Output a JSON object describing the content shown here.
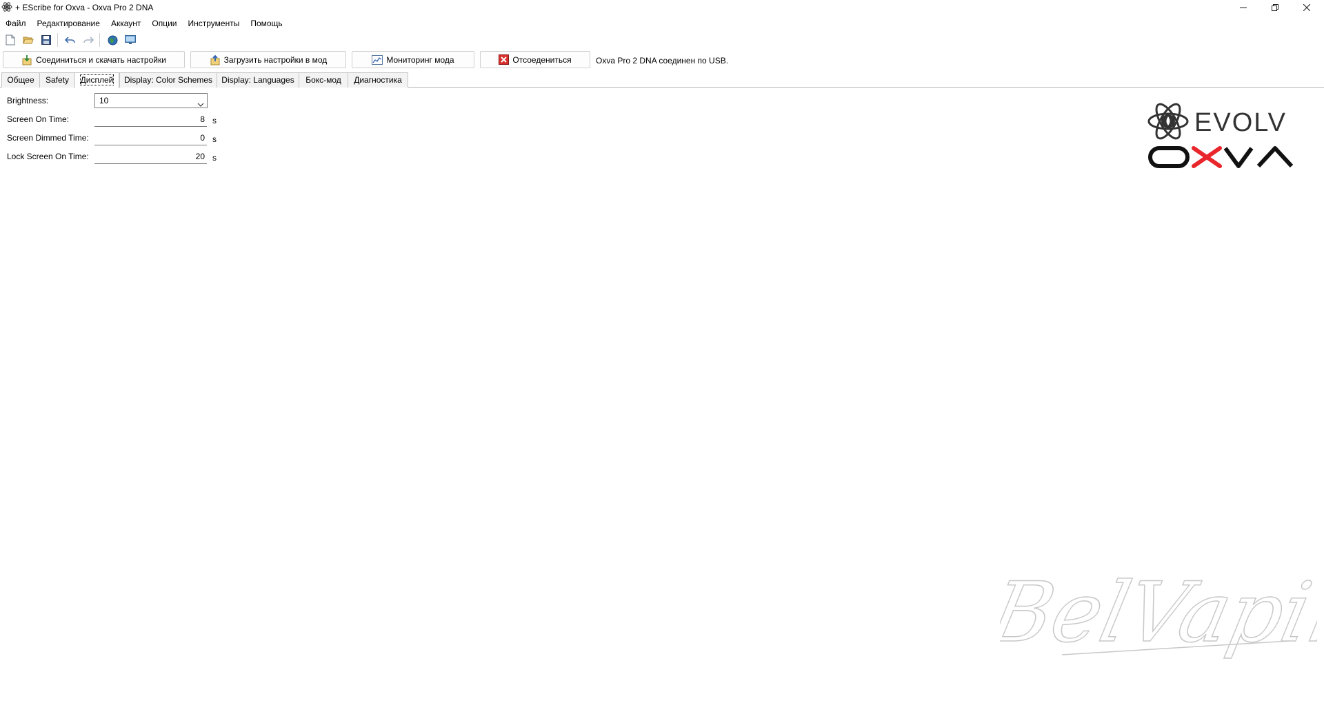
{
  "window": {
    "title": "+ EScribe for Oxva - Oxva Pro 2 DNA",
    "icon": "atom-icon",
    "controls": [
      "minimize-icon",
      "maximize-icon",
      "close-icon"
    ]
  },
  "menu": [
    "Файл",
    "Редактирование",
    "Аккаунт",
    "Опции",
    "Инструменты",
    "Помощь"
  ],
  "toolbar": [
    "new-file-icon",
    "open-folder-icon",
    "save-icon",
    "undo-icon",
    "redo-icon",
    "globe-icon",
    "monitor-icon"
  ],
  "actions": {
    "connect": "Соединиться и скачать настройки",
    "upload": "Загрузить настройки в мод",
    "monitor": "Мониторинг мода",
    "disconnect": "Отсоедениться"
  },
  "status": "Oxva Pro 2 DNA соединен по USB.",
  "tabs": [
    "Общее",
    "Safety",
    "Дисплей",
    "Display: Color Schemes",
    "Display: Languages",
    "Бокс-мод",
    "Диагностика"
  ],
  "active_tab": "Дисплей",
  "form": {
    "brightness_label": "Brightness:",
    "brightness_value": "10",
    "screen_on_label": "Screen On Time:",
    "screen_on_value": "8",
    "screen_dimmed_label": "Screen Dimmed Time:",
    "screen_dimmed_value": "0",
    "lock_screen_label": "Lock Screen On Time:",
    "lock_screen_value": "20",
    "unit": "s"
  },
  "logos": {
    "evolv": "EVOLV",
    "oxva": "OXVA",
    "watermark": "BelVaping"
  },
  "colors": {
    "oxva_x": "#e8262b",
    "logo_dark": "#333333",
    "watermark": "#c8c8c8"
  }
}
